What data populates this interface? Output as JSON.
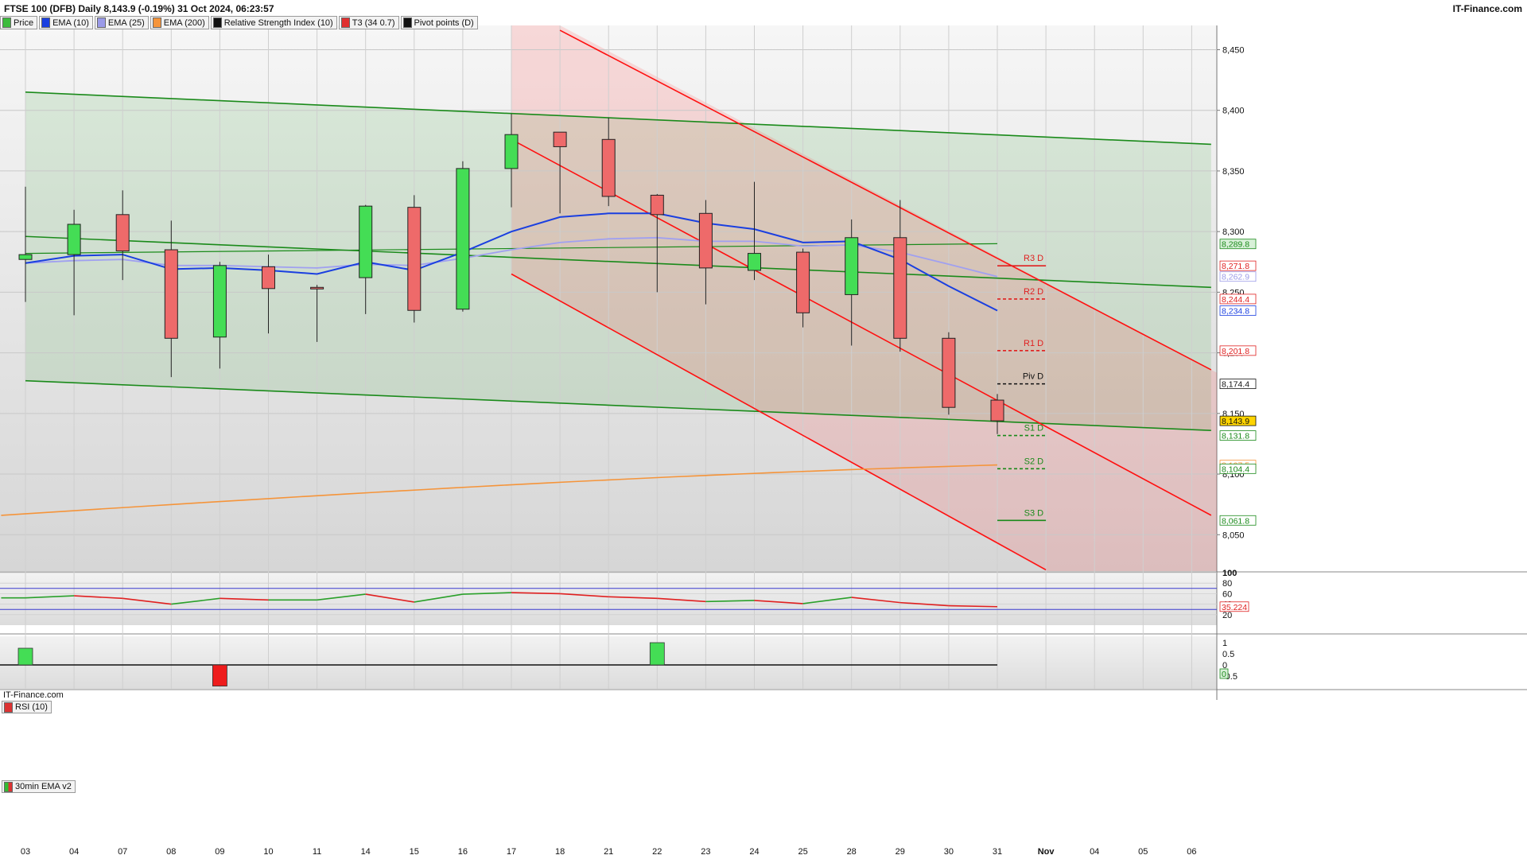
{
  "header": {
    "title": "FTSE 100 (DFB) Daily 8,143.9 (-0.19%) 31 Oct 2024, 06:23:57",
    "brand": "IT-Finance.com",
    "watermark": "IT-Finance.com"
  },
  "legend": [
    {
      "label": "Price",
      "color": "#3dbb3d"
    },
    {
      "label": "EMA (10)",
      "color": "#1a3fe0"
    },
    {
      "label": "EMA (25)",
      "color": "#9a9ae8"
    },
    {
      "label": "EMA (200)",
      "color": "#f5943a"
    },
    {
      "label": "Relative Strength Index (10)",
      "color": "#111111"
    },
    {
      "label": "T3 (34 0.7)",
      "color": "#e03030"
    },
    {
      "label": "Pivot points (D)",
      "color": "#111111"
    }
  ],
  "colors": {
    "up": "#44dd55",
    "down": "#ee6a6a",
    "channel_green": "#1a8a1a",
    "channel_red": "#ff1010",
    "ema10": "#1a3fe0",
    "ema25": "#a0a0f0",
    "ema200": "#f5943a"
  },
  "chart_data": [
    {
      "type": "candlestick",
      "title": "FTSE 100 (DFB) Daily",
      "categories": [
        "03",
        "04",
        "07",
        "08",
        "09",
        "10",
        "11",
        "14",
        "15",
        "16",
        "17",
        "18",
        "21",
        "22",
        "23",
        "24",
        "25",
        "28",
        "29",
        "30",
        "31",
        "Nov",
        "04",
        "05",
        "06"
      ],
      "ylim": [
        8020,
        8470
      ],
      "yticks": [
        8350,
        8300,
        8250,
        8200,
        8150,
        8100,
        8050,
        8400,
        8450
      ],
      "ytick_labels": [
        "8,350",
        "8,300",
        "8,250",
        "8,200",
        "8,150",
        "8,100",
        "8,050",
        "8,400",
        "8,450"
      ],
      "ohlc": [
        {
          "x": "03",
          "o": 8277,
          "h": 8337,
          "l": 8242,
          "c": 8281
        },
        {
          "x": "04",
          "o": 8281,
          "h": 8318,
          "l": 8231,
          "c": 8306
        },
        {
          "x": "07",
          "o": 8314,
          "h": 8334,
          "l": 8260,
          "c": 8284
        },
        {
          "x": "08",
          "o": 8285,
          "h": 8309,
          "l": 8180,
          "c": 8212
        },
        {
          "x": "09",
          "o": 8213,
          "h": 8275,
          "l": 8187,
          "c": 8272
        },
        {
          "x": "10",
          "o": 8271,
          "h": 8281,
          "l": 8216,
          "c": 8253
        },
        {
          "x": "11",
          "o": 8254,
          "h": 8256,
          "l": 8209,
          "c": 8253
        },
        {
          "x": "14",
          "o": 8262,
          "h": 8322,
          "l": 8232,
          "c": 8321
        },
        {
          "x": "15",
          "o": 8320,
          "h": 8330,
          "l": 8225,
          "c": 8235
        },
        {
          "x": "16",
          "o": 8236,
          "h": 8358,
          "l": 8234,
          "c": 8352
        },
        {
          "x": "17",
          "o": 8352,
          "h": 8397,
          "l": 8320,
          "c": 8380
        },
        {
          "x": "18",
          "o": 8382,
          "h": 8382,
          "l": 8315,
          "c": 8370
        },
        {
          "x": "21",
          "o": 8376,
          "h": 8394,
          "l": 8321,
          "c": 8329
        },
        {
          "x": "22",
          "o": 8330,
          "h": 8331,
          "l": 8250,
          "c": 8314
        },
        {
          "x": "23",
          "o": 8315,
          "h": 8326,
          "l": 8240,
          "c": 8270
        },
        {
          "x": "24",
          "o": 8268,
          "h": 8341,
          "l": 8260,
          "c": 8282
        },
        {
          "x": "25",
          "o": 8283,
          "h": 8286,
          "l": 8221,
          "c": 8233
        },
        {
          "x": "28",
          "o": 8248,
          "h": 8310,
          "l": 8206,
          "c": 8295
        },
        {
          "x": "29",
          "o": 8295,
          "h": 8326,
          "l": 8201,
          "c": 8212
        },
        {
          "x": "30",
          "o": 8212,
          "h": 8217,
          "l": 8149,
          "c": 8155
        },
        {
          "x": "31",
          "o": 8161,
          "h": 8166,
          "l": 8133,
          "c": 8143.9
        }
      ],
      "ema10": [
        8274,
        8280,
        8281,
        8269,
        8270,
        8268,
        8265,
        8275,
        8268,
        8283,
        8300,
        8312,
        8315,
        8315,
        8307,
        8302,
        8291,
        8292,
        8277,
        8255,
        8234.8
      ],
      "ema25": [
        8274,
        8276,
        8277,
        8272,
        8272,
        8271,
        8270,
        8273,
        8272,
        8278,
        8285,
        8291,
        8294,
        8295,
        8292,
        8292,
        8288,
        8289,
        8283,
        8273,
        8262.9
      ],
      "ema200": [
        {
          "x": "-0.5",
          "y": 8066
        },
        {
          "x": "31",
          "y": 8107.5
        }
      ],
      "green_channel": {
        "upper": [
          {
            "x": "03",
            "y": 8415
          },
          {
            "x": "06+0.4",
            "y": 8372
          }
        ],
        "middle": [
          {
            "x": "03",
            "y": 8296
          },
          {
            "x": "06+0.4",
            "y": 8254
          }
        ],
        "lower": [
          {
            "x": "03",
            "y": 8177
          },
          {
            "x": "06+0.4",
            "y": 8136
          }
        ],
        "fill_top_line": [
          {
            "x": "03",
            "y": 8282
          },
          {
            "x": "31",
            "y": 8290
          }
        ]
      },
      "red_channel": {
        "upper": [
          {
            "x": "18",
            "y": 8466
          },
          {
            "x": "06+0.4",
            "y": 8186
          }
        ],
        "middle": [
          {
            "x": "17",
            "y": 8376
          },
          {
            "x": "06+0.4",
            "y": 8066
          }
        ],
        "lower": [
          {
            "x": "17",
            "y": 8265
          },
          {
            "x": "Nov",
            "y": 8021
          }
        ]
      },
      "pivots": [
        {
          "label": "R3 D",
          "value": 8271.8,
          "color": "#e02020",
          "dash": false
        },
        {
          "label": "R2 D",
          "value": 8244.4,
          "color": "#e02020",
          "dash": true
        },
        {
          "label": "R1 D",
          "value": 8201.8,
          "color": "#e02020",
          "dash": true
        },
        {
          "label": "Piv D",
          "value": 8174.4,
          "color": "#111111",
          "dash": true
        },
        {
          "label": "S1 D",
          "value": 8131.8,
          "color": "#1a8a1a",
          "dash": true
        },
        {
          "label": "S2 D",
          "value": 8104.4,
          "color": "#1a8a1a",
          "dash": true
        },
        {
          "label": "S3 D",
          "value": 8061.8,
          "color": "#1a8a1a",
          "dash": false
        }
      ],
      "price_tags": [
        {
          "value": 8289.8,
          "text": "8,289.8",
          "bg": "#d8f0d8",
          "fg": "#1a8a1a"
        },
        {
          "value": 8271.8,
          "text": "8,271.8",
          "bg": "#ffffff",
          "fg": "#e02020"
        },
        {
          "value": 8262.9,
          "text": "8,262.9",
          "bg": "#ffffff",
          "fg": "#9a9ae8"
        },
        {
          "value": 8244.4,
          "text": "8,244.4",
          "bg": "#ffffff",
          "fg": "#e02020"
        },
        {
          "value": 8234.8,
          "text": "8,234.8",
          "bg": "#ffffff",
          "fg": "#1a3fe0"
        },
        {
          "value": 8201.8,
          "text": "8,201.8",
          "bg": "#ffffff",
          "fg": "#e02020"
        },
        {
          "value": 8174.4,
          "text": "8,174.4",
          "bg": "#ffffff",
          "fg": "#111111"
        },
        {
          "value": 8143.9,
          "text": "8,143.9",
          "bg": "#ffd400",
          "fg": "#111111"
        },
        {
          "value": 8131.8,
          "text": "8,131.8",
          "bg": "#ffffff",
          "fg": "#1a8a1a"
        },
        {
          "value": 8107.5,
          "text": "8,107.5",
          "bg": "#ffffff",
          "fg": "#f5943a"
        },
        {
          "value": 8104.4,
          "text": "8,104.4",
          "bg": "#ffffff",
          "fg": "#1a8a1a"
        },
        {
          "value": 8061.8,
          "text": "8,061.8",
          "bg": "#ffffff",
          "fg": "#1a8a1a"
        }
      ]
    },
    {
      "type": "line",
      "title": "RSI (10)",
      "ylim": [
        0,
        100
      ],
      "yticks": [
        100,
        80,
        60,
        40,
        20
      ],
      "ytick_labels": [
        "100",
        "80",
        "60",
        "40",
        "20"
      ],
      "levels": [
        70,
        30
      ],
      "x": [
        "-0.5",
        "03",
        "04",
        "07",
        "08",
        "09",
        "10",
        "11",
        "14",
        "15",
        "16",
        "17",
        "18",
        "21",
        "22",
        "23",
        "24",
        "25",
        "28",
        "29",
        "30",
        "31"
      ],
      "values": [
        52,
        52,
        56,
        51,
        40,
        51,
        48,
        48,
        59,
        44,
        59,
        62,
        60,
        54,
        51,
        45,
        47,
        41,
        53,
        43,
        37,
        35.224
      ],
      "last_label": "35.224"
    },
    {
      "type": "bar",
      "title": "30min EMA v2",
      "ylim": [
        -1,
        1
      ],
      "yticks": [
        1,
        0.5,
        0,
        -0.5
      ],
      "ytick_labels": [
        "1",
        "0.5",
        "0",
        "-0.5"
      ],
      "bars": [
        {
          "x": "03",
          "value": 0.75
        },
        {
          "x": "09",
          "value": -0.95
        },
        {
          "x": "22",
          "value": 1.0
        }
      ],
      "last_label": "0"
    }
  ]
}
